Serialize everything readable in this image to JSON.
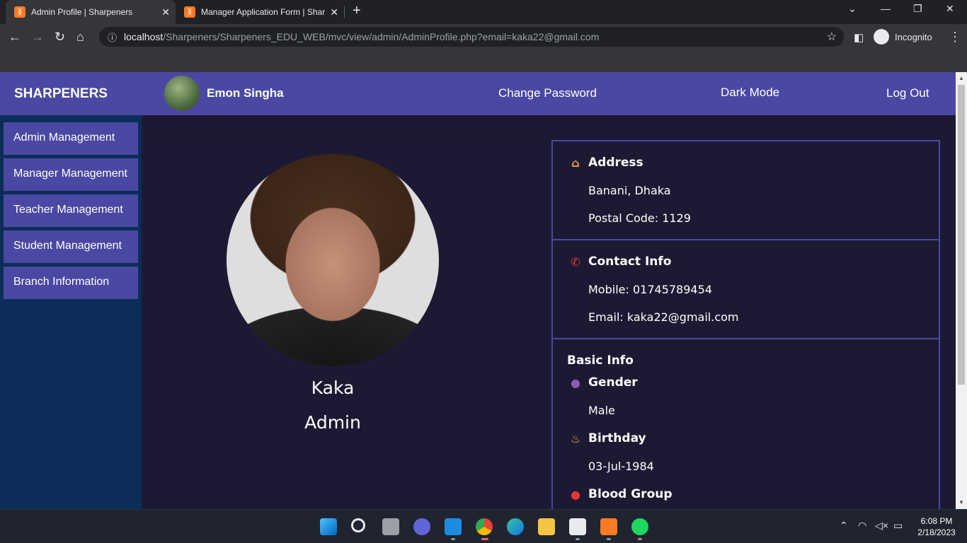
{
  "browser": {
    "tabs": [
      {
        "title": "Admin Profile | Sharpeners",
        "active": true
      },
      {
        "title": "Manager Application Form | Shar",
        "active": false
      }
    ],
    "url_host": "localhost",
    "url_path": "/Sharpeners/Sharpeners_EDU_WEB/mvc/view/admin/AdminProfile.php?email=kaka22@gmail.com",
    "incognito_label": "Incognito"
  },
  "header": {
    "brand": "SHARPENERS",
    "username": "Emon Singha",
    "links": {
      "change_password": "Change Password",
      "dark_mode": "Dark Mode",
      "logout": "Log Out"
    }
  },
  "sidebar": {
    "items": [
      {
        "label": "Admin Management"
      },
      {
        "label": "Manager Management"
      },
      {
        "label": "Teacher Management"
      },
      {
        "label": "Student Management"
      },
      {
        "label": "Branch Information"
      }
    ]
  },
  "profile": {
    "name": "Kaka",
    "role": "Admin"
  },
  "address": {
    "title": "Address",
    "icon": "house-icon",
    "line1": "Banani, Dhaka",
    "line2": "Postal Code: 1129"
  },
  "contact": {
    "title": "Contact Info",
    "icon": "phone-icon",
    "mobile": "Mobile: 01745789454",
    "email": "Email: kaka22@gmail.com"
  },
  "basic": {
    "title": "Basic Info",
    "gender_title": "Gender",
    "gender": "Male",
    "birthday_title": "Birthday",
    "birthday": "03-Jul-1984",
    "blood_title": "Blood Group"
  },
  "taskbar": {
    "time": "6:08 PM",
    "date": "2/18/2023"
  },
  "colors": {
    "header": "#4a48a3",
    "sidebar": "#0b2d57",
    "page_bg": "#1c1a33",
    "card_border": "#4a48a3"
  }
}
